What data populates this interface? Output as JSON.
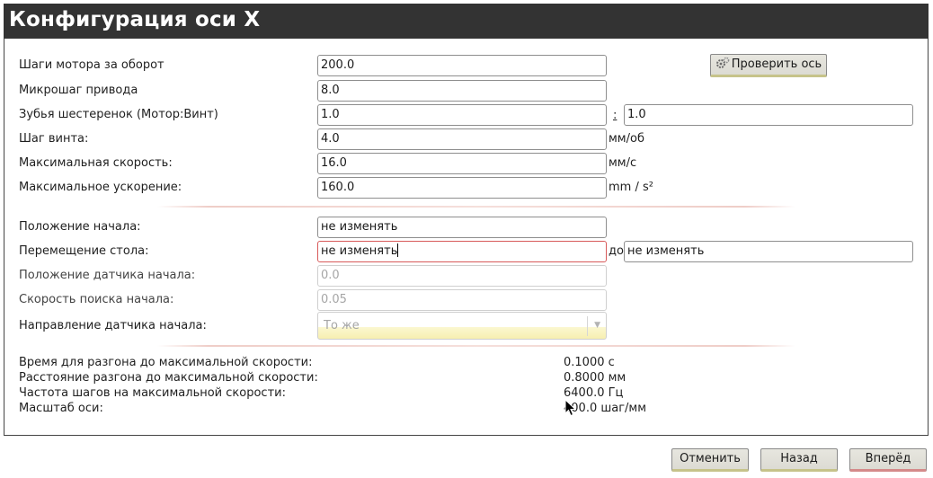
{
  "header": {
    "title": "Конфигурация оси X"
  },
  "fields": {
    "steps_per_rev": {
      "label": "Шаги мотора за оборот",
      "value": "200.0"
    },
    "microstep": {
      "label": "Микрошаг привода",
      "value": "8.0"
    },
    "gear_teeth": {
      "label": "Зубья шестеренок (Мотор:Винт)",
      "motor_value": "1.0",
      "separator": ":",
      "screw_value": "1.0"
    },
    "screw_pitch": {
      "label": "Шаг винта:",
      "value": "4.0",
      "unit": "мм/об"
    },
    "max_velocity": {
      "label": "Максимальная скорость:",
      "value": "16.0",
      "unit": "мм/с"
    },
    "max_accel": {
      "label": "Максимальное ускорение:",
      "value": "160.0",
      "unit": "mm / s²"
    },
    "home_position": {
      "label": "Положение начала:",
      "value": "не изменять"
    },
    "table_travel": {
      "label": "Перемещение стола:",
      "from_value": "не изменять",
      "to_label": "до",
      "to_value": "не изменять"
    },
    "home_switch_position": {
      "label": "Положение датчика начала:",
      "value": "0.0"
    },
    "home_search_velocity": {
      "label": "Скорость поиска начала:",
      "value": "0.05"
    },
    "home_switch_direction": {
      "label": "Направление датчика начала:",
      "value": "То же"
    }
  },
  "test_axis_button": {
    "label": "Проверить ось",
    "icon": "gear-icon"
  },
  "info": {
    "accel_time": {
      "label": "Время для разгона до максимальной скорости:",
      "value": "0.1000 с"
    },
    "accel_distance": {
      "label": "Расстояние разгона до максимальной скорости:",
      "value": "0.8000 мм"
    },
    "step_rate": {
      "label": "Частота шагов на максимальной скорости:",
      "value": "6400.0 Гц"
    },
    "axis_scale": {
      "label": "Масштаб оси:",
      "value": "400.0 шаг/мм"
    }
  },
  "footer": {
    "cancel_label": "Отменить",
    "back_label": "Назад",
    "next_label": "Вперёд"
  }
}
